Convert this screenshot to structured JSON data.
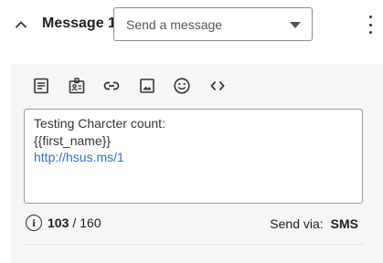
{
  "header": {
    "title": "Message 1",
    "select": {
      "value": "Send a message"
    }
  },
  "toolbar": {
    "icons": [
      "document-icon",
      "contact-card-icon",
      "link-icon",
      "image-icon",
      "emoji-icon",
      "code-icon"
    ]
  },
  "message": {
    "lines": [
      "Testing Charcter count:",
      "{{first_name}}",
      "http://hsus.ms/1"
    ],
    "link_color": "#2f6fc6"
  },
  "counter": {
    "current": "103",
    "separator": "/",
    "max": "160"
  },
  "send_via": {
    "label": "Send via:",
    "value": "SMS"
  }
}
